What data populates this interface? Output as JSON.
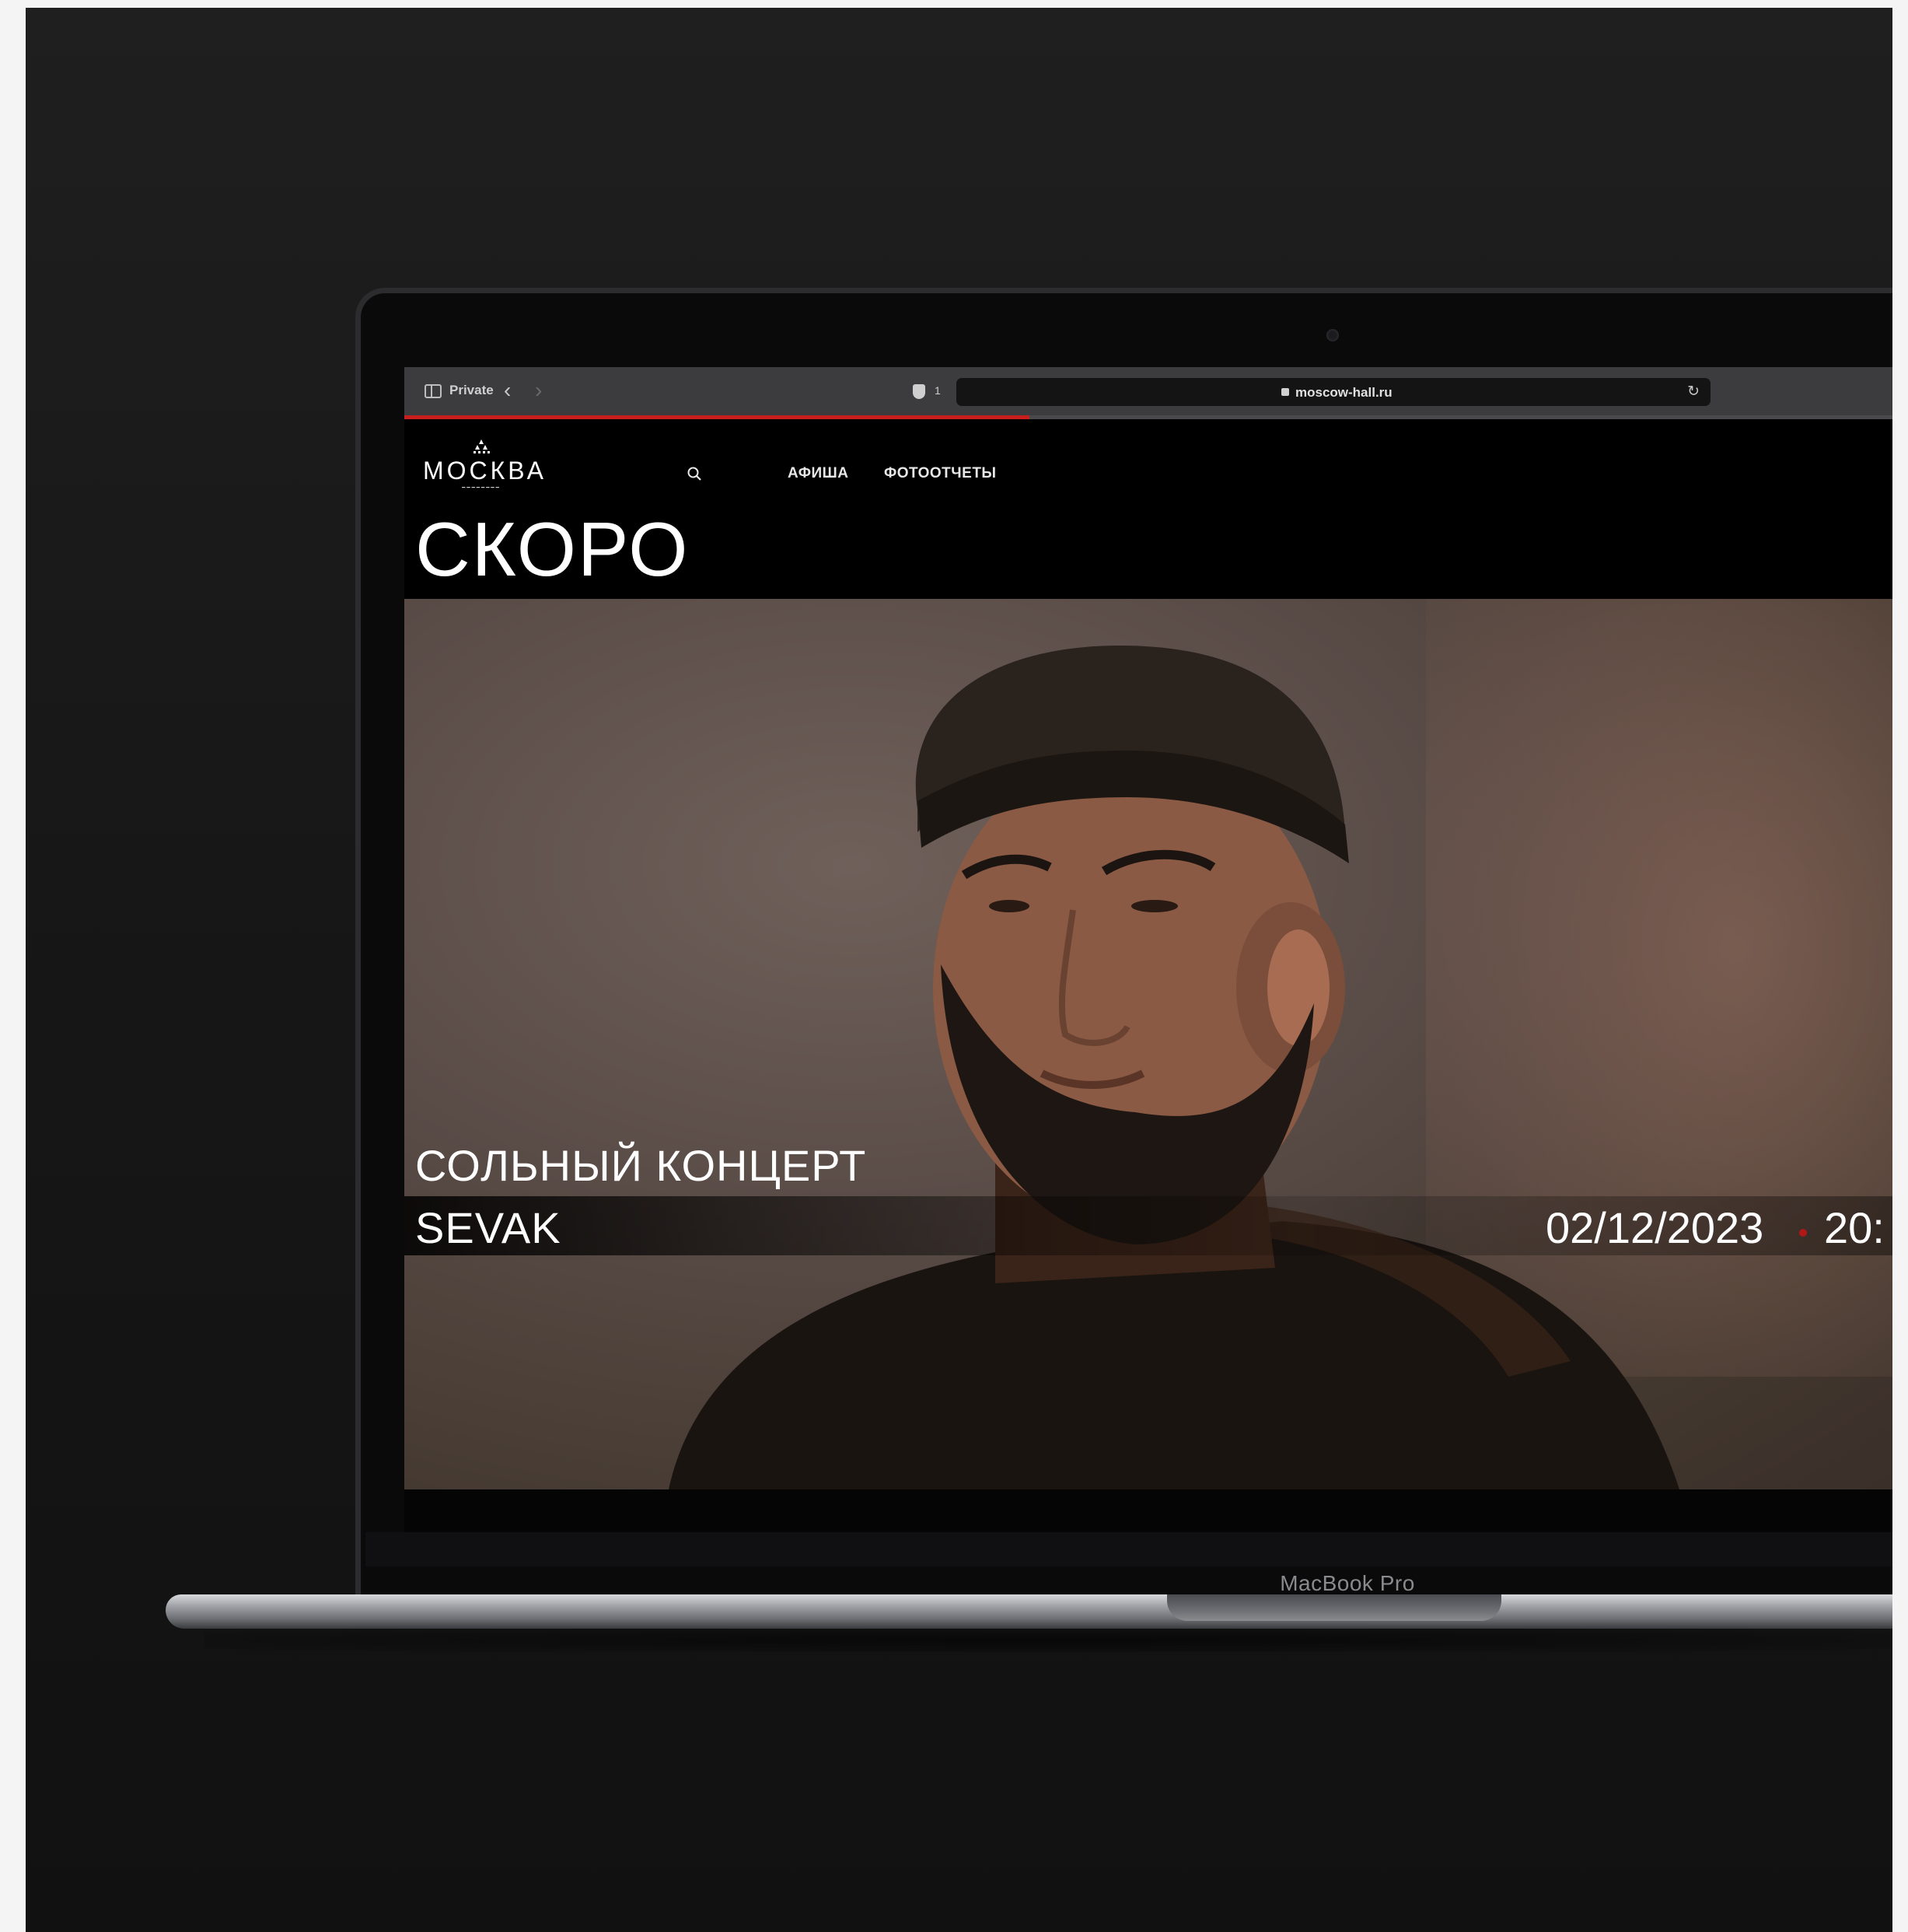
{
  "browser": {
    "private_label": "Private",
    "tracker_count": "1",
    "url": "moscow-hall.ru",
    "load_progress": 0.42
  },
  "site": {
    "logo_word": "МОСКВА",
    "nav": [
      {
        "label": "АФИША"
      },
      {
        "label": "ФОТООТЧЕТЫ"
      }
    ],
    "heading": "СКОРО"
  },
  "event": {
    "subtitle": "СОЛЬНЫЙ КОНЦЕРТ",
    "artist": "SEVAK",
    "date": "02/12/2023",
    "time": "20:"
  },
  "device": {
    "label": "MacBook Pro"
  },
  "colors": {
    "accent": "#c81e1e",
    "background": "#000000"
  },
  "icons": {
    "sidebar": "sidebar-icon",
    "back": "chevron-left-icon",
    "forward": "chevron-right-icon",
    "shield": "shield-icon",
    "lock": "lock-icon",
    "reload": "reload-icon",
    "search": "search-icon"
  }
}
